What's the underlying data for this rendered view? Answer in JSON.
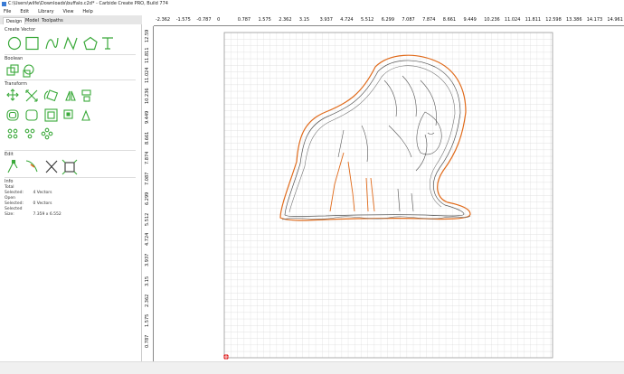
{
  "window": {
    "title": "C:\\Users\\wilfe\\Downloads\\buffalo.c2d* - Carbide Create PRO, Build 774"
  },
  "menu": [
    "File",
    "Edit",
    "Library",
    "View",
    "Help"
  ],
  "tabs": [
    {
      "label": "Design",
      "active": true
    },
    {
      "label": "Model",
      "active": false
    },
    {
      "label": "Toolpaths",
      "active": false
    }
  ],
  "sections": {
    "create_vector": {
      "title": "Create Vector"
    },
    "boolean": {
      "title": "Boolean"
    },
    "transform": {
      "title": "Transform"
    },
    "edit": {
      "title": "Edit"
    },
    "info": {
      "title": "Info"
    }
  },
  "info": {
    "total_selected_label": "Total Selected:",
    "total_selected_value": "4 Vectors",
    "open_selected_label": "Open Selected:",
    "open_selected_value": "0 Vectors",
    "selected_size_label": "Selected Size:",
    "selected_size_value": "7.359 x 6.552"
  },
  "ruler": {
    "h_labels": [
      "-2.362",
      "-1.575",
      "-0.787",
      "0",
      "0.787",
      "1.575",
      "2.362",
      "3.15",
      "3.937",
      "4.724",
      "5.512",
      "6.299",
      "7.087",
      "7.874",
      "8.661",
      "9.449",
      "10.236",
      "11.024",
      "11.811",
      "12.598",
      "13.386",
      "14.173",
      "14.961"
    ],
    "v_labels": [
      "12.59",
      "11.811",
      "11.024",
      "10.236",
      "9.449",
      "8.661",
      "7.874",
      "7.087",
      "6.299",
      "5.512",
      "4.724",
      "3.937",
      "3.15",
      "2.362",
      "1.575",
      "0.787",
      "0"
    ]
  },
  "colors": {
    "icon_green": "#3aa93a",
    "selection_orange": "#e06a1a",
    "grid": "#d8d8d8",
    "marker_red": "#e02020"
  },
  "icons": {
    "circle": "circle-icon",
    "rect": "rectangle-icon",
    "curve": "curve-icon",
    "polyline": "polyline-icon",
    "polygon": "polygon-icon",
    "text": "text-icon"
  }
}
